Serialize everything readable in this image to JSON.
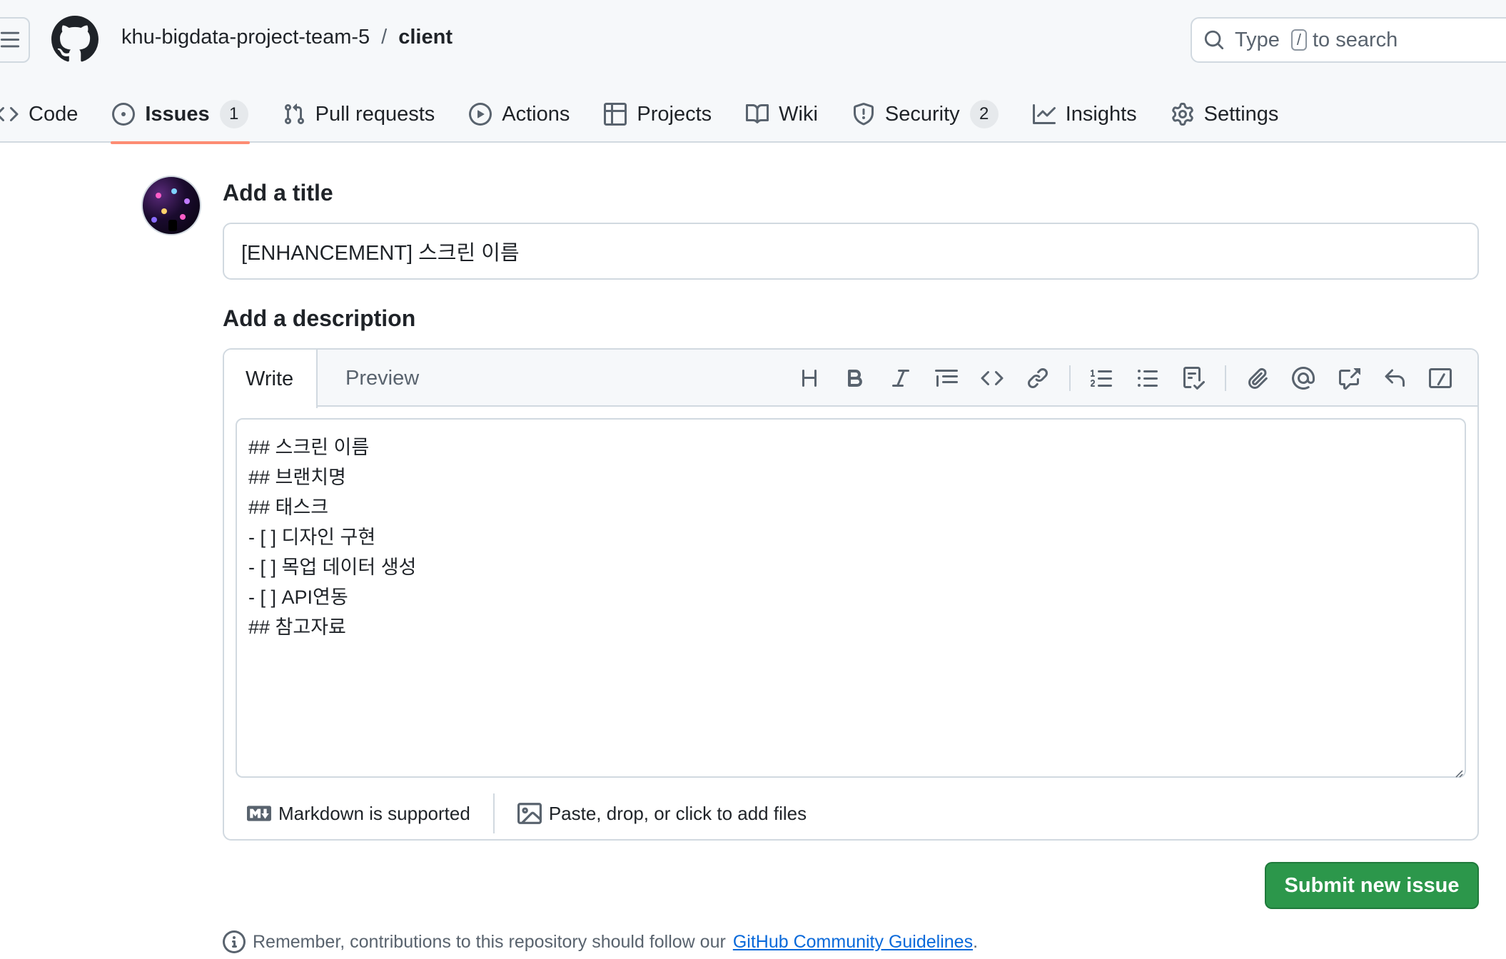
{
  "header": {
    "owner": "khu-bigdata-project-team-5",
    "separator": "/",
    "repo": "client",
    "search": {
      "prefix": "Type",
      "key": "/",
      "suffix": "to search"
    }
  },
  "tabs": [
    {
      "label": "Code",
      "icon": "code-icon"
    },
    {
      "label": "Issues",
      "icon": "issue-opened-icon",
      "count": "1",
      "active": true
    },
    {
      "label": "Pull requests",
      "icon": "git-pull-request-icon"
    },
    {
      "label": "Actions",
      "icon": "play-icon"
    },
    {
      "label": "Projects",
      "icon": "table-icon"
    },
    {
      "label": "Wiki",
      "icon": "book-icon"
    },
    {
      "label": "Security",
      "icon": "shield-icon",
      "count": "2"
    },
    {
      "label": "Insights",
      "icon": "graph-icon"
    },
    {
      "label": "Settings",
      "icon": "gear-icon"
    }
  ],
  "form": {
    "title_heading": "Add a title",
    "title_value": "[ENHANCEMENT] 스크린 이름",
    "description_heading": "Add a description",
    "write_tab": "Write",
    "preview_tab": "Preview",
    "body": "## 스크린 이름\n## 브랜치명\n## 태스크\n- [ ] 디자인 구현\n- [ ] 목업 데이터 생성\n- [ ] API연동\n## 참고자료",
    "markdown_note": "Markdown is supported",
    "attach_note": "Paste, drop, or click to add files",
    "submit_label": "Submit new issue"
  },
  "footer": {
    "remember_text": "Remember, contributions to this repository should follow our",
    "guidelines_link": "GitHub Community Guidelines",
    "period": "."
  },
  "colors": {
    "accent_underline": "#fd8c73",
    "submit_green": "#2c974b",
    "link_blue": "#0969da"
  }
}
